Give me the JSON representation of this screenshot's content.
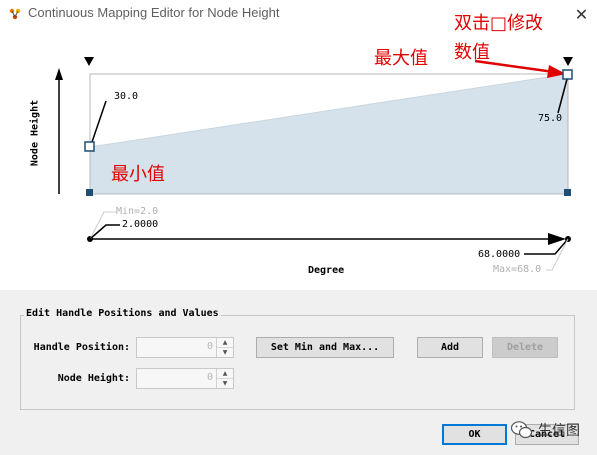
{
  "window": {
    "title": "Continuous Mapping Editor for Node Height",
    "close_glyph": "✕"
  },
  "plot": {
    "y_axis_label": "Node Height",
    "x_axis_label": "Degree",
    "left_point_value": "30.0",
    "right_point_value": "75.0",
    "min_label": "Min=2.0",
    "max_label": "Max=68.0",
    "x_left_value": "2.0000",
    "x_right_value": "68.0000"
  },
  "annotations": {
    "max_value": "最大值",
    "min_value": "最小值",
    "double_click_line1": "双击□修改",
    "double_click_line2": "数值"
  },
  "edit_group": {
    "title": "Edit Handle Positions and Values",
    "handle_position_label": "Handle Position:",
    "handle_position_value": "0",
    "node_height_label": "Node Height:",
    "node_height_value": "0",
    "set_min_max_label": "Set Min and Max...",
    "add_label": "Add",
    "delete_label": "Delete"
  },
  "footer": {
    "ok_label": "OK",
    "cancel_label": "Cancel"
  },
  "watermark": {
    "name": "生信图"
  },
  "colors": {
    "fill": "#d5e2eb",
    "handle": "#1d4e73",
    "annotation": "#e00000",
    "ok_border": "#0078d7"
  },
  "chart_data": {
    "type": "area",
    "x": [
      2.0,
      68.0
    ],
    "y": [
      30.0,
      75.0
    ],
    "xlim": [
      2.0,
      68.0
    ],
    "xlabel": "Degree",
    "ylabel": "Node Height"
  }
}
